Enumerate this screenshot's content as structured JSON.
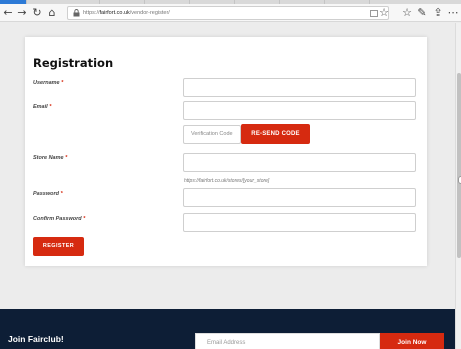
{
  "browser": {
    "url_host": "fairfort.co.uk",
    "url_prefix": "https://",
    "url_path": "/vendor-register/"
  },
  "form": {
    "title": "Registration",
    "username_label": "Username",
    "email_label": "Email",
    "required_mark": "*",
    "verification_placeholder": "Verification Code",
    "resend_label": "RE-SEND CODE",
    "store_name_label": "Store Name",
    "store_url_hint": "https://fairfort.co.uk/stores/[your_store]",
    "password_label": "Password",
    "confirm_password_label": "Confirm Password",
    "register_label": "REGISTER"
  },
  "footer": {
    "join_title": "Join Fairclub!",
    "email_placeholder": "Email Address",
    "join_button": "Join Now"
  },
  "icons": [
    "back-icon",
    "forward-icon",
    "refresh-icon",
    "home-icon",
    "lock-icon",
    "reader-view-icon",
    "favorite-star-icon",
    "favorites-bar-icon",
    "pen-icon",
    "share-icon",
    "more-icon"
  ],
  "colors": {
    "accent": "#d62a10",
    "footer_bg": "#0d1e36"
  }
}
